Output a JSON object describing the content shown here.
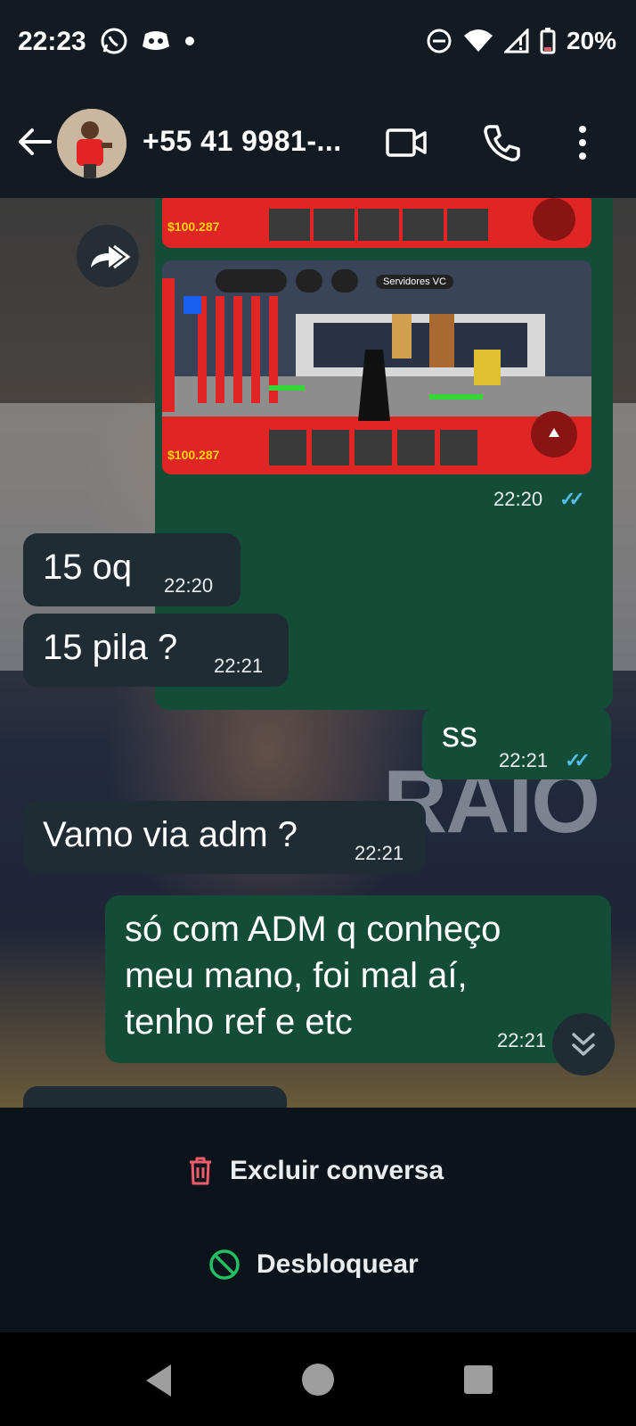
{
  "status_bar": {
    "time": "22:23",
    "battery": "20%",
    "icons": [
      "whatsapp-icon",
      "discord-icon",
      "dot-icon",
      "dnd-icon",
      "wifi-icon",
      "signal-icon",
      "battery-icon"
    ]
  },
  "header": {
    "contact_name": "+55 41 9981-...",
    "icons": [
      "back-arrow-icon",
      "video-call-icon",
      "phone-icon",
      "more-icon"
    ]
  },
  "media_message": {
    "screenshot_top": {
      "money": "$100.287"
    },
    "screenshot_bottom": {
      "money": "$100.287",
      "server_label": "Servidores VC"
    },
    "time": "22:20",
    "status": "read"
  },
  "messages": [
    {
      "direction": "in",
      "text": "15 oq",
      "time": "22:20"
    },
    {
      "direction": "in",
      "text": "15 pila ?",
      "time": "22:21"
    },
    {
      "direction": "out",
      "text": "ss",
      "time": "22:21",
      "status": "read"
    },
    {
      "direction": "in",
      "text": "Vamo via adm ?",
      "time": "22:21"
    },
    {
      "direction": "out",
      "lines": [
        "só com ADM q conheço",
        "meu mano, foi mal aí,",
        "tenho ref e etc"
      ],
      "time": "22:21"
    }
  ],
  "actions": {
    "delete_label": "Excluir conversa",
    "unblock_label": "Desbloquear",
    "delete_color": "#f15c6d",
    "unblock_color": "#21c063"
  },
  "colors": {
    "incoming_bubble": "#1f2c34",
    "outgoing_bubble": "#144d37",
    "read_ticks": "#53bdeb"
  }
}
